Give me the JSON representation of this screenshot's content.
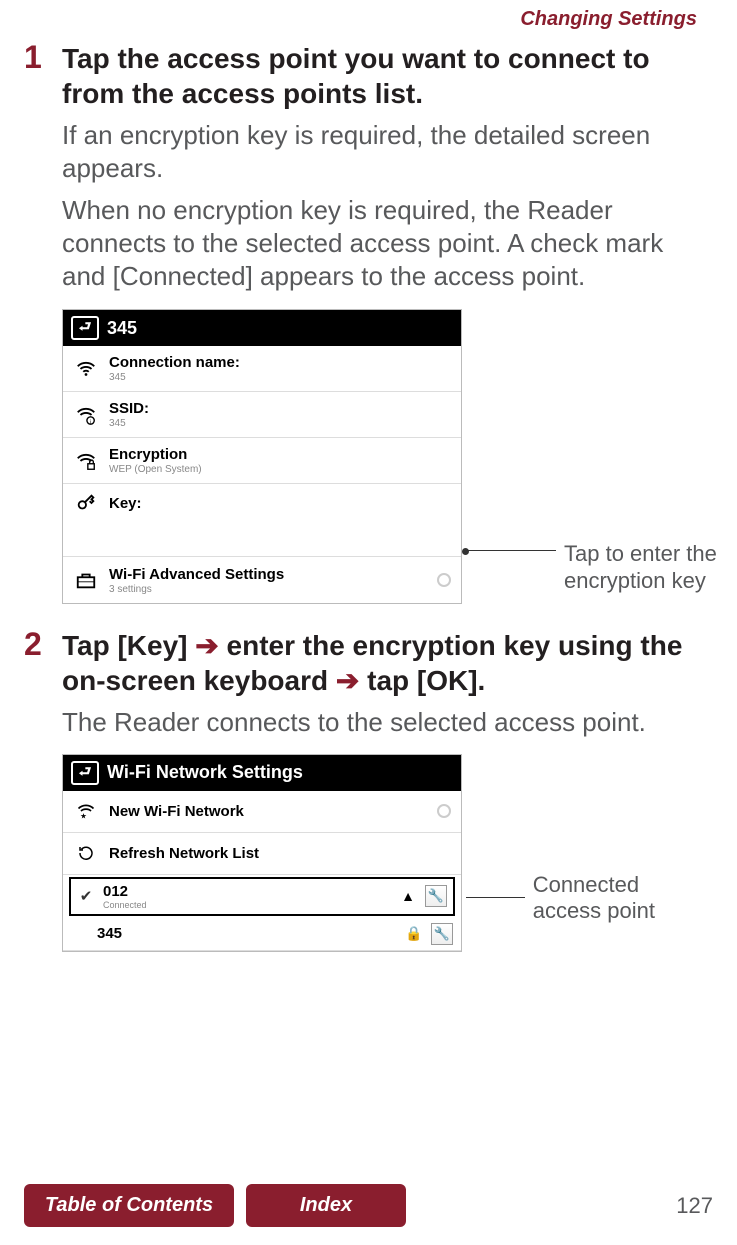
{
  "header": {
    "section": "Changing Settings"
  },
  "step1": {
    "num": "1",
    "title": "Tap the access point you want to connect to from the access points list.",
    "para1": "If an encryption key is required, the detailed screen appears.",
    "para2": "When no encryption key is required, the Reader connects to the selected access point. A check mark and [Connected] appears to the access point."
  },
  "fig1": {
    "title": "345",
    "rows": {
      "conn": {
        "label": "Connection name:",
        "sub": "345"
      },
      "ssid": {
        "label": "SSID:",
        "sub": "345"
      },
      "enc": {
        "label": "Encryption",
        "sub": "WEP (Open System)"
      },
      "key": {
        "label": "Key:"
      },
      "adv": {
        "label": "Wi-Fi Advanced Settings",
        "sub": "3 settings"
      }
    },
    "callout": "Tap to enter the encryption key"
  },
  "step2": {
    "num": "2",
    "title_pre": "Tap [Key] ",
    "title_mid1": " enter the encryption key using the on-screen keyboard ",
    "title_post": " tap [OK].",
    "para": "The Reader connects to the selected access point."
  },
  "fig2": {
    "title": "Wi-Fi Network Settings",
    "newnet": "New Wi-Fi Network",
    "refresh": "Refresh Network List",
    "ap1": {
      "name": "012",
      "status": "Connected"
    },
    "ap2": {
      "name": "345"
    },
    "callout": "Connected access point"
  },
  "footer": {
    "toc": "Table of Contents",
    "index": "Index",
    "page": "127"
  }
}
